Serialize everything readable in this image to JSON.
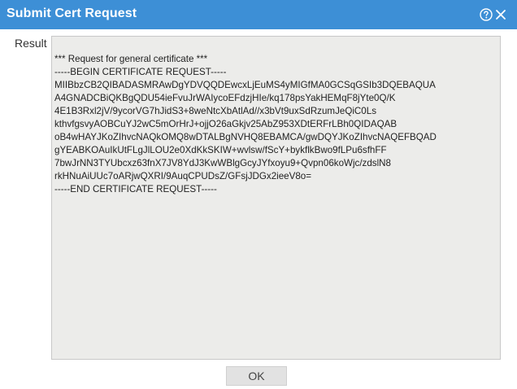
{
  "window": {
    "title": "Submit Cert Request"
  },
  "icons": {
    "help": "help-icon",
    "close": "close-icon"
  },
  "colors": {
    "titlebar": "#3d8fd6",
    "result_background": "#ececea",
    "button_background": "#e2e2e2"
  },
  "form": {
    "result_label": "Result",
    "result_lines": [
      "*** Request for general certificate ***",
      "-----BEGIN CERTIFICATE REQUEST-----",
      "MIIBbzCB2QIBADASMRAwDgYDVQQDEwcxLjEuMS4yMIGfMA0GCSqGSIb3DQEBAQUA",
      "A4GNADCBiQKBgQDU54ieFvuJrWAIycoEFdzjHIe/kq178psYakHEMqF8jYte0Q/K",
      "4E1B3Rxl2jV/9ycorVG7hJidS3+8weNtcXbAtlAd//x3bVt9uxSdRzumJeQiC0Ls",
      "kthvfgsvyAOBCuYJ2wC5mOrHrJ+ojjO26aGkjv25AbZ953XDtERFrLBh0QIDAQAB",
      "oB4wHAYJKoZIhvcNAQkOMQ8wDTALBgNVHQ8EBAMCA/gwDQYJKoZIhvcNAQEFBQAD",
      "gYEABKOAuIkUtFLgJlLOU2e0XdKkSKIW+wvlsw/fScY+bykflkBwo9fLPu6sfhFF",
      "7bwJrNN3TYUbcxz63fnX7JV8YdJ3KwWBlgGcyJYfxoyu9+Qvpn06koWjc/zdslN8",
      "rkHNuAiUUc7oARjwQXRI/9AuqCPUDsZ/GFsjJDGx2ieeV8o=",
      "-----END CERTIFICATE REQUEST-----"
    ]
  },
  "buttons": {
    "ok_label": "OK"
  }
}
